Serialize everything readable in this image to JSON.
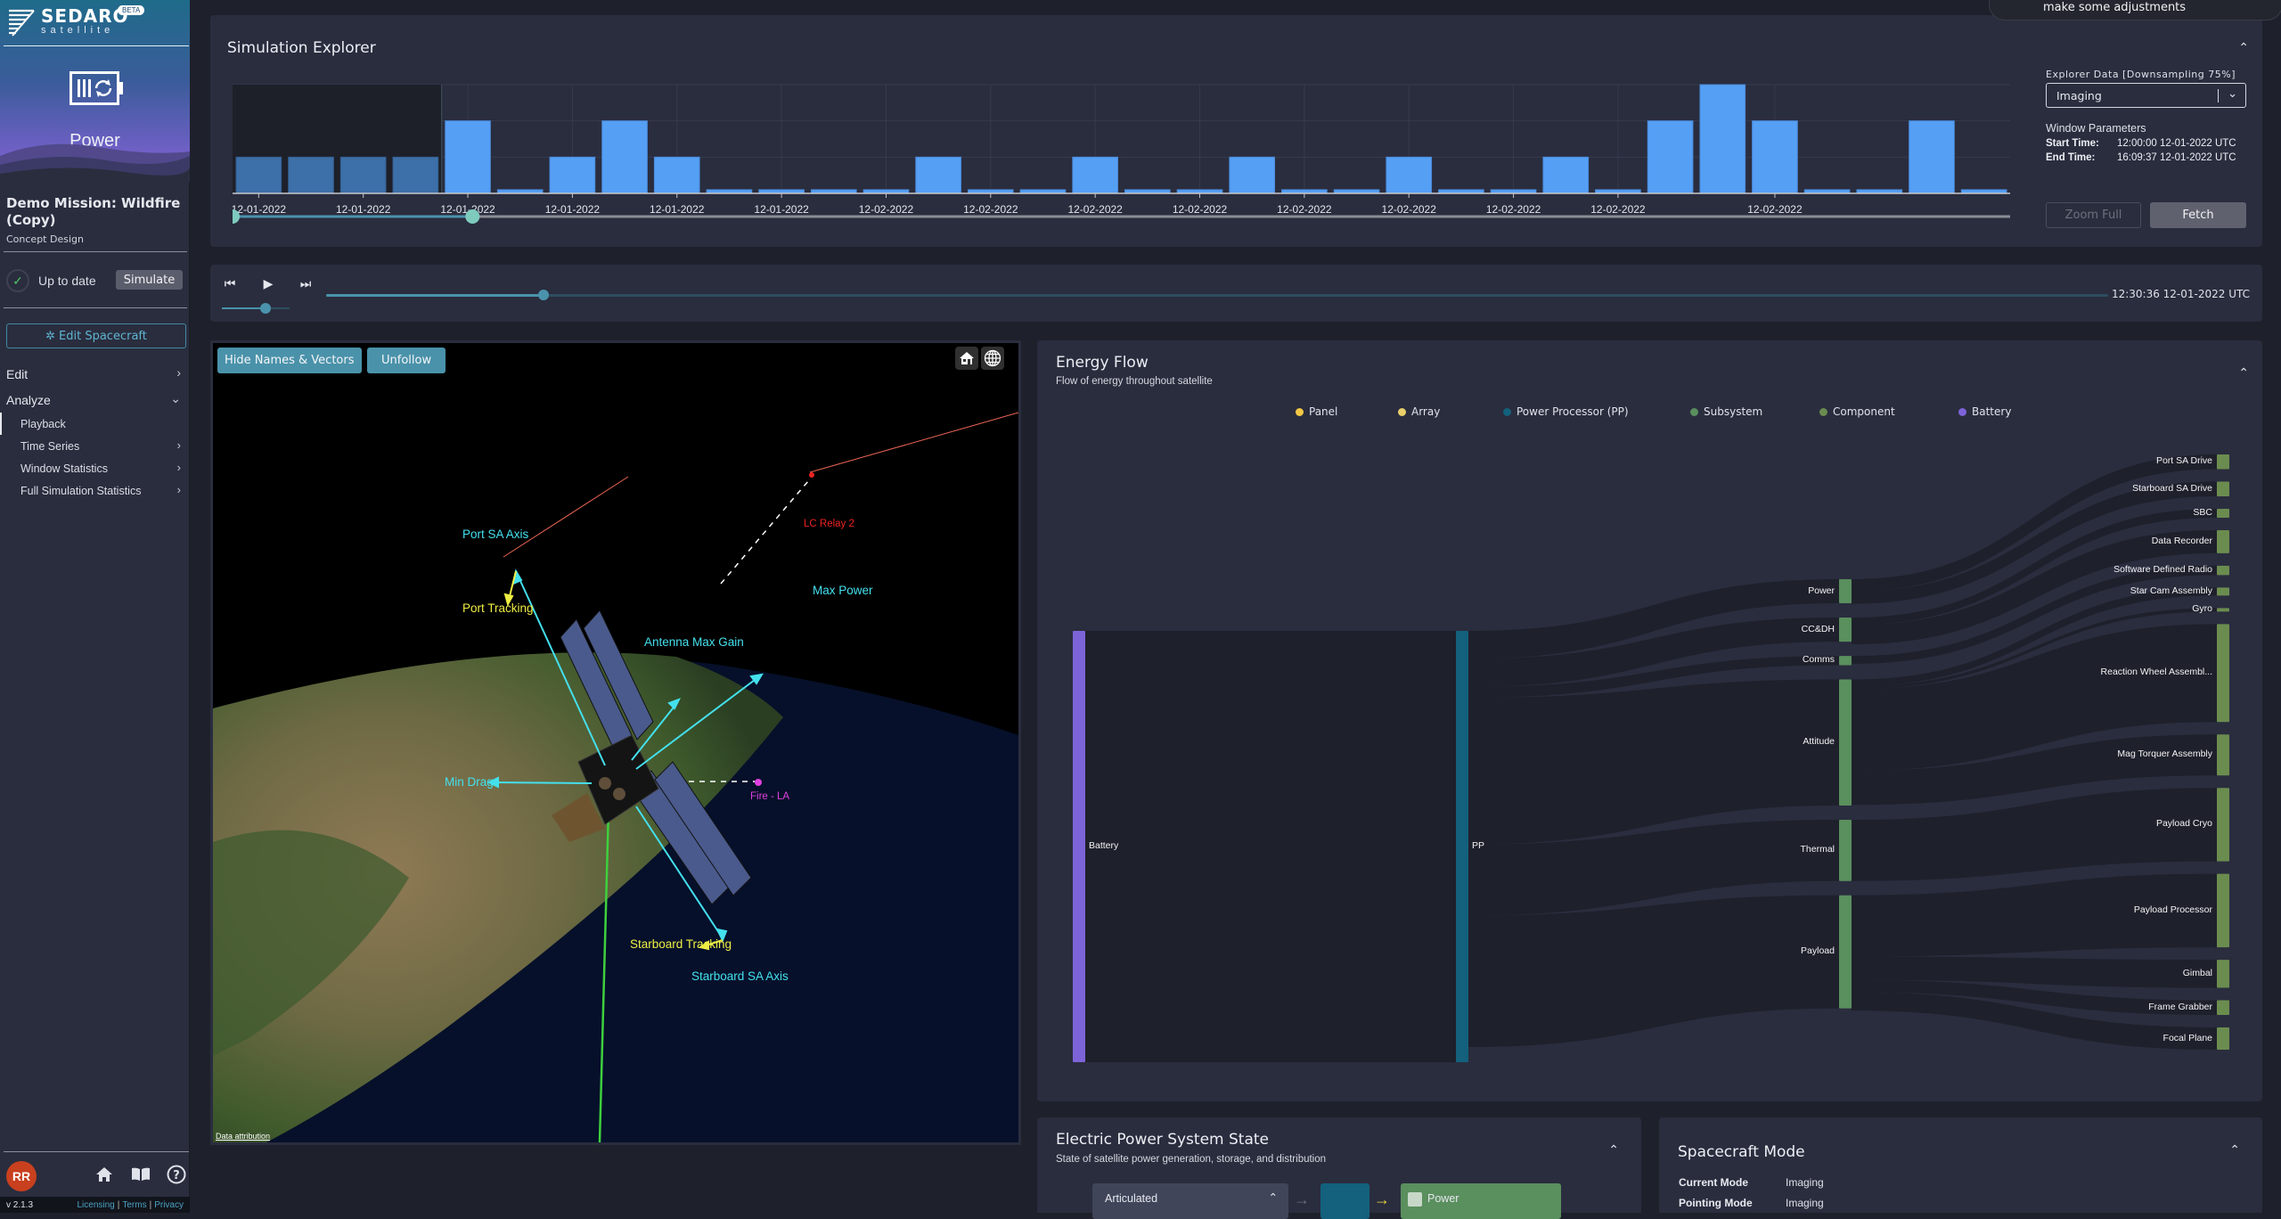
{
  "app": {
    "brand": "SEDARO",
    "brand_sub": "satellite",
    "badge": "BETA",
    "module": "Power",
    "module_icon": "battery-sync-icon"
  },
  "sidebar": {
    "mission_title": "Demo Mission: Wildfire (Copy)",
    "mission_subtitle": "Concept Design",
    "status": "Up to date",
    "simulate_label": "Simulate",
    "edit_spacecraft_label": "Edit Spacecraft",
    "nav": [
      {
        "label": "Edit",
        "expanded": false
      },
      {
        "label": "Analyze",
        "expanded": true
      }
    ],
    "analyze_items": [
      {
        "label": "Playback",
        "active": true,
        "has_children": false
      },
      {
        "label": "Time Series",
        "active": false,
        "has_children": true
      },
      {
        "label": "Window Statistics",
        "active": false,
        "has_children": true
      },
      {
        "label": "Full Simulation Statistics",
        "active": false,
        "has_children": true
      }
    ],
    "user_initials": "RR",
    "version": "v 2.1.3",
    "footer_links": [
      "Licensing",
      "Terms",
      "Privacy"
    ]
  },
  "toast": {
    "text": "make some adjustments"
  },
  "explorer": {
    "title": "Simulation Explorer",
    "data_label": "Explorer Data [Downsampling 75%]",
    "data_value": "Imaging",
    "window_title": "Window Parameters",
    "start_label": "Start Time:",
    "start_value": "12:00:00 12-01-2022 UTC",
    "end_label": "End Time:",
    "end_value": "16:09:37 12-01-2022 UTC",
    "zoom_full_label": "Zoom Full",
    "fetch_label": "Fetch",
    "window_range_fraction": [
      0.0,
      0.135
    ]
  },
  "chart_data": {
    "type": "bar",
    "title": "Simulation Explorer",
    "xlabel": "",
    "ylabel": "",
    "ylim": [
      0,
      3
    ],
    "grid": true,
    "tick_labels": [
      "12-01-2022",
      "12-01-2022",
      "12-01-2022",
      "12-01-2022",
      "12-01-2022",
      "12-01-2022",
      "12-02-2022",
      "12-02-2022",
      "12-02-2022",
      "12-02-2022",
      "12-02-2022",
      "12-02-2022",
      "12-02-2022",
      "12-02-2022",
      "12-02-2022"
    ],
    "tick_positions": [
      0.5,
      2.5,
      4.5,
      6.5,
      8.5,
      10.5,
      12.5,
      14.5,
      16.5,
      18.5,
      20.5,
      22.5,
      24.5,
      26.5,
      29.5
    ],
    "values": [
      1,
      1,
      1,
      1,
      2,
      0.1,
      1,
      2,
      1,
      0.1,
      0.1,
      0.1,
      0.1,
      1,
      0.1,
      0.1,
      1,
      0.1,
      0.1,
      1,
      0.1,
      0.1,
      1,
      0.1,
      0.1,
      1,
      0.1,
      2,
      3,
      2,
      0.1,
      0.1,
      2,
      0.1
    ],
    "selected_bars": [
      0,
      1,
      2,
      3
    ]
  },
  "playback": {
    "time": "12:30:36 12-01-2022 UTC",
    "progress": 0.122,
    "speed": 0.65
  },
  "viewer": {
    "hide_label": "Hide Names & Vectors",
    "unfollow_label": "Unfollow",
    "attribution": "Data attribution",
    "labels": [
      {
        "text": "Port SA Axis",
        "color": "#44e0ee"
      },
      {
        "text": "Port Tracking",
        "color": "#eeee44"
      },
      {
        "text": "Antenna Max Gain",
        "color": "#44e0ee"
      },
      {
        "text": "Max Power",
        "color": "#44e0ee"
      },
      {
        "text": "LC Relay 2",
        "color": "#ee2222"
      },
      {
        "text": "Min Drag",
        "color": "#44e0ee"
      },
      {
        "text": "Fire - LA",
        "color": "#e040e0"
      },
      {
        "text": "Starboard Tracking",
        "color": "#eeee44"
      },
      {
        "text": "Starboard SA Axis",
        "color": "#44e0ee"
      }
    ]
  },
  "energy": {
    "title": "Energy Flow",
    "subtitle": "Flow of energy throughout satellite",
    "legend": [
      {
        "label": "Panel",
        "color": "#f2c744"
      },
      {
        "label": "Array",
        "color": "#e8cf6a"
      },
      {
        "label": "Power Processor (PP)",
        "color": "#13617d"
      },
      {
        "label": "Subsystem",
        "color": "#5a8f5e"
      },
      {
        "label": "Component",
        "color": "#6b8c4f"
      },
      {
        "label": "Battery",
        "color": "#7d63d8"
      }
    ],
    "nodes": {
      "source": {
        "label": "Battery",
        "color": "#7d63d8",
        "value": 100
      },
      "pp": {
        "label": "PP",
        "color": "#13617d",
        "value": 100
      },
      "subsystems": [
        {
          "label": "Power",
          "value": 6.5
        },
        {
          "label": "CC&DH",
          "value": 6.5
        },
        {
          "label": "Comms",
          "value": 2.5
        },
        {
          "label": "Attitude",
          "value": 34
        },
        {
          "label": "Thermal",
          "value": 16.5
        },
        {
          "label": "Payload",
          "value": 30.5
        }
      ],
      "components": [
        {
          "label": "Port SA Drive",
          "value": 3.3,
          "from": "Power"
        },
        {
          "label": "Starboard SA Drive",
          "value": 3.3,
          "from": "Power"
        },
        {
          "label": "SBC",
          "value": 2.0,
          "from": "CC&DH"
        },
        {
          "label": "Data Recorder",
          "value": 5.2,
          "from": "CC&DH"
        },
        {
          "label": "Software Defined Radio",
          "value": 2.1,
          "from": "Comms"
        },
        {
          "label": "Star Cam Assembly",
          "value": 1.8,
          "from": "Attitude"
        },
        {
          "label": "Gyro",
          "value": 0.8,
          "from": "Attitude"
        },
        {
          "label": "Reaction Wheel Assembl...",
          "value": 22,
          "from": "Attitude"
        },
        {
          "label": "Mag Torquer Assembly",
          "value": 9.2,
          "from": "Attitude"
        },
        {
          "label": "Payload Cryo",
          "value": 16.5,
          "from": "Thermal"
        },
        {
          "label": "Payload Processor",
          "value": 16.5,
          "from": "Payload"
        },
        {
          "label": "Gimbal",
          "value": 6.3,
          "from": "Payload"
        },
        {
          "label": "Frame Grabber",
          "value": 3.3,
          "from": "Payload"
        },
        {
          "label": "Focal Plane",
          "value": 5.0,
          "from": "Payload"
        }
      ]
    }
  },
  "eps": {
    "title": "Electric Power System State",
    "subtitle": "State of satellite power generation, storage, and distribution",
    "array_label": "Articulated",
    "power_label": "Power"
  },
  "mode": {
    "title": "Spacecraft Mode",
    "rows": [
      {
        "label": "Current Mode",
        "value": "Imaging"
      },
      {
        "label": "Pointing Mode",
        "value": "Imaging"
      }
    ]
  }
}
